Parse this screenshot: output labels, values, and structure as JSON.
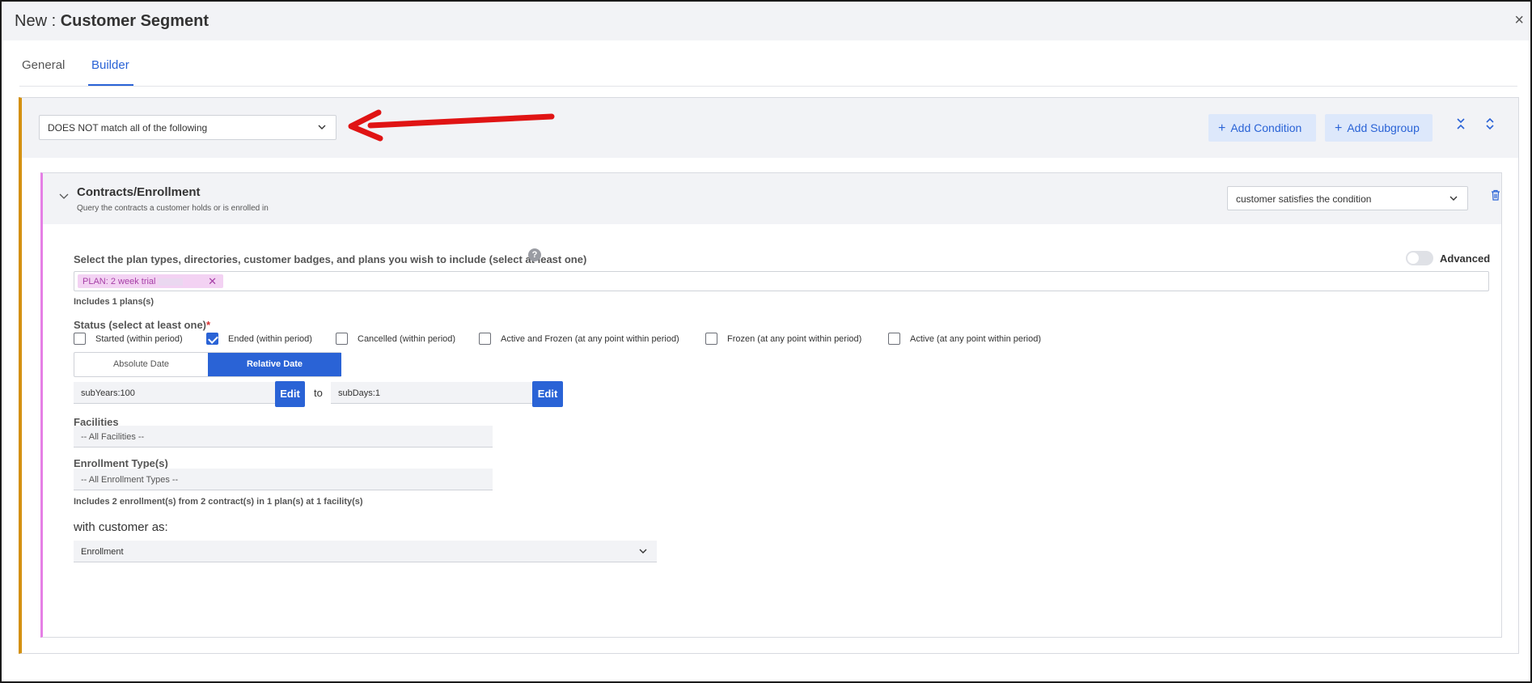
{
  "window": {
    "title_prefix": "New : ",
    "title_main": "Customer Segment",
    "close_glyph": "×"
  },
  "tabs": [
    {
      "label": "General",
      "active": false
    },
    {
      "label": "Builder",
      "active": true
    }
  ],
  "group": {
    "match_mode": "DOES NOT match all of the following",
    "add_condition_label": "Add Condition",
    "add_subgroup_label": "Add Subgroup",
    "accent_color": "#d4900f"
  },
  "condition": {
    "title": "Contracts/Enrollment",
    "subtitle": "Query the contracts a customer holds or is enrolled in",
    "satisfies_mode": "customer satisfies the condition",
    "accent_color": "#e57fe5",
    "plan_select_label": "Select the plan types, directories, customer badges, and plans you wish to include (select at least one)",
    "advanced_label": "Advanced",
    "advanced_enabled": false,
    "tags": [
      {
        "label": "PLAN: 2 week trial"
      }
    ],
    "includes_plans_text": "Includes 1 plans(s)",
    "status_label": "Status (select at least one)",
    "required_marker": "*",
    "statuses": [
      {
        "label": "Started (within period)",
        "checked": false
      },
      {
        "label": "Ended (within period)",
        "checked": true
      },
      {
        "label": "Cancelled (within period)",
        "checked": false
      },
      {
        "label": "Active and Frozen (at any point within period)",
        "checked": false
      },
      {
        "label": "Frozen (at any point within period)",
        "checked": false
      },
      {
        "label": "Active (at any point within period)",
        "checked": false
      }
    ],
    "date_modes": {
      "absolute": "Absolute Date",
      "relative": "Relative Date",
      "selected": "Relative Date"
    },
    "date_from": "subYears:100",
    "date_to": "subDays:1",
    "edit_label": "Edit",
    "to_label": "to",
    "facilities_label": "Facilities",
    "facilities_value": "-- All Facilities --",
    "enrollment_types_label": "Enrollment Type(s)",
    "enrollment_types_value": "-- All Enrollment Types --",
    "includes_enrollments_text": "Includes 2 enrollment(s) from 2 contract(s) in 1 plan(s) at 1 facility(s)",
    "with_customer_label": "with customer as:",
    "with_customer_value": "Enrollment"
  },
  "colors": {
    "primary": "#2a63d6",
    "annotation_arrow": "#e01414"
  }
}
